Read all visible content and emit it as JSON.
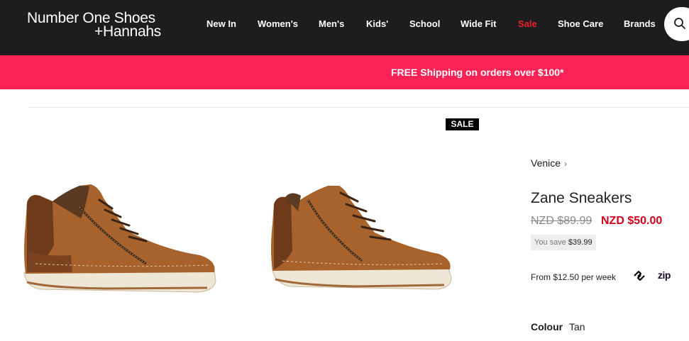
{
  "header": {
    "logo_line1": "Number One Shoes",
    "logo_line2": "+Hannahs",
    "nav": [
      {
        "label": "New In",
        "name": "nav-new-in"
      },
      {
        "label": "Women's",
        "name": "nav-womens"
      },
      {
        "label": "Men's",
        "name": "nav-mens"
      },
      {
        "label": "Kids'",
        "name": "nav-kids"
      },
      {
        "label": "School",
        "name": "nav-school"
      },
      {
        "label": "Wide Fit",
        "name": "nav-wide-fit"
      },
      {
        "label": "Sale",
        "name": "nav-sale"
      },
      {
        "label": "Shoe Care",
        "name": "nav-shoe-care"
      },
      {
        "label": "Brands",
        "name": "nav-brands"
      }
    ],
    "search_icon": "search-icon"
  },
  "promo": {
    "text": "FREE Shipping on orders over $100*"
  },
  "gallery": {
    "badge": "SALE",
    "images": [
      "shoe-side-view",
      "shoe-angled-view"
    ]
  },
  "product": {
    "brand": "Venice",
    "title": "Zane Sneakers",
    "price_original": "NZD $89.99",
    "price_sale": "NZD $50.00",
    "save_label": "You save",
    "save_amount": "$39.99",
    "installment_text": "From $12.50 per week",
    "payment_providers": [
      "afterpay-icon",
      "zip"
    ],
    "zip_label": "zip",
    "colour_label": "Colour",
    "colour_value": "Tan"
  },
  "colors": {
    "header_bg": "#1d1d1f",
    "promo_bg": "#fb2355",
    "sale_price": "#d0021b",
    "sale_nav": "#e8202b"
  }
}
